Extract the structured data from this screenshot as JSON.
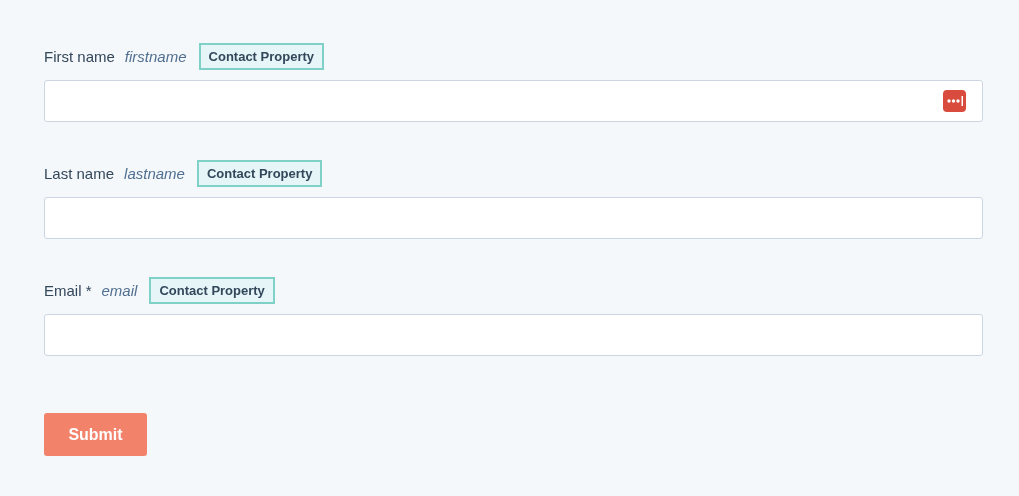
{
  "fields": [
    {
      "label": "First name",
      "internal_name": "firstname",
      "tag": "Contact Property",
      "autofill": true
    },
    {
      "label": "Last name",
      "internal_name": "lastname",
      "tag": "Contact Property",
      "autofill": false
    },
    {
      "label": "Email *",
      "internal_name": "email",
      "tag": "Contact Property",
      "autofill": false
    }
  ],
  "submit": {
    "label": "Submit"
  }
}
